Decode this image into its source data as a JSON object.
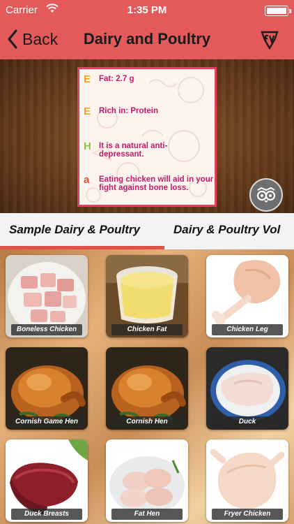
{
  "status_bar": {
    "carrier": "Carrier",
    "time": "1:35 PM"
  },
  "nav": {
    "back_label": "Back",
    "title": "Dairy and Poultry"
  },
  "fact_card": {
    "facts": [
      {
        "glyph": "E",
        "glyph_color": "#f0a41c",
        "text": "Fat: 2.7 g"
      },
      {
        "glyph": "E",
        "glyph_color": "#f0a41c",
        "text": "Rich in: Protein"
      },
      {
        "glyph": "H",
        "glyph_color": "#8bc34a",
        "text": "It is a natural anti-depressant."
      },
      {
        "glyph": "a",
        "glyph_color": "#e0503a",
        "text": "Eating chicken will aid in your fight against bone loss."
      }
    ]
  },
  "actions": {
    "owl_icon": "owl-icon",
    "share_icon": "share-icon"
  },
  "tabs": [
    {
      "label": "Sample Dairy & Poultry",
      "selected": true
    },
    {
      "label": "Dairy & Poultry Vol"
    }
  ],
  "colors": {
    "accent": "#e45a5a",
    "tab_indicator": "#e0504a",
    "fact_text": "#c71a6f",
    "share_button": "#27a3d8"
  },
  "items": [
    {
      "label": "Boneless Chicken"
    },
    {
      "label": "Chicken Fat"
    },
    {
      "label": "Chicken Leg"
    },
    {
      "label": "Cornish Game Hen"
    },
    {
      "label": "Cornish Hen"
    },
    {
      "label": "Duck"
    },
    {
      "label": "Duck Breasts"
    },
    {
      "label": "Fat Hen"
    },
    {
      "label": "Fryer Chicken"
    }
  ]
}
